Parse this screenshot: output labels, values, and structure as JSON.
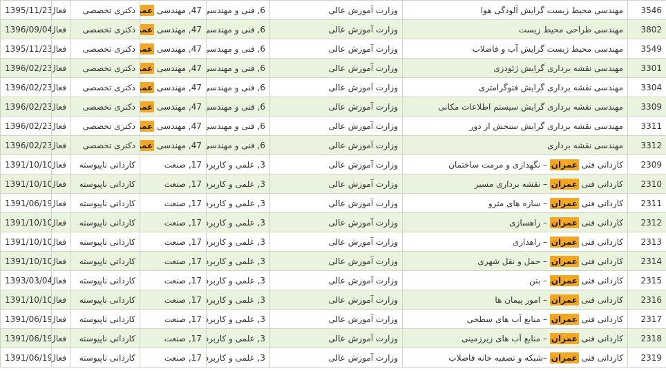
{
  "highlight": "عمران",
  "highlight_color": "#f5a623",
  "row_alt_color": "#eaf3dd",
  "rows": [
    {
      "code": "3546",
      "name_pre": "مهندسی محیط زیست گرایش آلودگی هوا",
      "name_hl": "",
      "name_post": "",
      "org": "وزارت آموزش عالی",
      "group": "6, فنی و مهندسی",
      "field_pre": "47, مهندسی ",
      "field_hl": "عمران",
      "level": "دکتری تخصصی",
      "status": "فعال",
      "date": "1395/11/23"
    },
    {
      "code": "3802",
      "name_pre": "مهندسی طراحی محیط زیست",
      "name_hl": "",
      "name_post": "",
      "org": "وزارت آموزش عالی",
      "group": "6, فنی و مهندسی",
      "field_pre": "47, مهندسی ",
      "field_hl": "عمران",
      "level": "دکتری تخصصی",
      "status": "فعال",
      "date": "1396/09/04"
    },
    {
      "code": "3549",
      "name_pre": "مهندسی محیط زیست گرایش آب و فاضلاب",
      "name_hl": "",
      "name_post": "",
      "org": "وزارت آموزش عالی",
      "group": "6, فنی و مهندسی",
      "field_pre": "47, مهندسی ",
      "field_hl": "عمران",
      "level": "دکتری تخصصی",
      "status": "فعال",
      "date": "1395/11/23"
    },
    {
      "code": "3301",
      "name_pre": "مهندسی نقشه برداری گرایش ژئودزی",
      "name_hl": "",
      "name_post": "",
      "org": "وزارت آموزش عالی",
      "group": "6, فنی و مهندسی",
      "field_pre": "47, مهندسی ",
      "field_hl": "عمران",
      "level": "دکتری تخصصی",
      "status": "فعال",
      "date": "1396/02/23"
    },
    {
      "code": "3304",
      "name_pre": "مهندسی نقشه برداری گرایش فتوگرامتری",
      "name_hl": "",
      "name_post": "",
      "org": "وزارت آموزش عالی",
      "group": "6, فنی و مهندسی",
      "field_pre": "47, مهندسی ",
      "field_hl": "عمران",
      "level": "دکتری تخصصی",
      "status": "فعال",
      "date": "1396/02/23"
    },
    {
      "code": "3309",
      "name_pre": "مهندسی نقشه برداری گرایش سیستم اطلاعات مکانی",
      "name_hl": "",
      "name_post": "",
      "org": "وزارت آموزش عالی",
      "group": "6, فنی و مهندسی",
      "field_pre": "47, مهندسی ",
      "field_hl": "عمران",
      "level": "دکتری تخصصی",
      "status": "فعال",
      "date": "1396/02/23"
    },
    {
      "code": "3311",
      "name_pre": "مهندسی نقشه برداری گرایش سنجش از دور",
      "name_hl": "",
      "name_post": "",
      "org": "وزارت آموزش عالی",
      "group": "6, فنی و مهندسی",
      "field_pre": "47, مهندسی ",
      "field_hl": "عمران",
      "level": "دکتری تخصصی",
      "status": "فعال",
      "date": "1396/02/23"
    },
    {
      "code": "3312",
      "name_pre": "مهندسی نقشه برداری",
      "name_hl": "",
      "name_post": "",
      "org": "وزارت آموزش عالی",
      "group": "6, فنی و مهندسی",
      "field_pre": "47, مهندسی ",
      "field_hl": "عمران",
      "level": "دکتری تخصصی",
      "status": "فعال",
      "date": "1396/02/23"
    },
    {
      "code": "2309",
      "name_pre": "کاردانی فنی ",
      "name_hl": "عمران",
      "name_post": " – نگهداری و مرمت ساختمان",
      "org": "وزارت آموزش عالی",
      "group": "3, علمی و کاربردی",
      "field_pre": "17, صنعت",
      "field_hl": "",
      "level": "کاردانی ناپیوسته",
      "status": "فعال",
      "date": "1391/10/10"
    },
    {
      "code": "2310",
      "name_pre": "کاردانی فنی ",
      "name_hl": "عمران",
      "name_post": " – نقشه برداری مسیر",
      "org": "وزارت آموزش عالی",
      "group": "3, علمی و کاربردی",
      "field_pre": "17, صنعت",
      "field_hl": "",
      "level": "کاردانی ناپیوسته",
      "status": "فعال",
      "date": "1391/10/10"
    },
    {
      "code": "2311",
      "name_pre": "کاردانی فنی ",
      "name_hl": "عمران",
      "name_post": " – سازه های مترو",
      "org": "وزارت آموزش عالی",
      "group": "3, علمی و کاربردی",
      "field_pre": "17, صنعت",
      "field_hl": "",
      "level": "کاردانی ناپیوسته",
      "status": "فعال",
      "date": "1391/06/19"
    },
    {
      "code": "2312",
      "name_pre": "کاردانی فنی ",
      "name_hl": "عمران",
      "name_post": " – راهسازی",
      "org": "وزارت آموزش عالی",
      "group": "3, علمی و کاربردی",
      "field_pre": "17, صنعت",
      "field_hl": "",
      "level": "کاردانی ناپیوسته",
      "status": "فعال",
      "date": "1391/10/10"
    },
    {
      "code": "2313",
      "name_pre": "کاردانی فنی ",
      "name_hl": "عمران",
      "name_post": " – راهداری",
      "org": "وزارت آموزش عالی",
      "group": "3, علمی و کاربردی",
      "field_pre": "17, صنعت",
      "field_hl": "",
      "level": "کاردانی ناپیوسته",
      "status": "فعال",
      "date": "1391/10/10"
    },
    {
      "code": "2314",
      "name_pre": "کاردانی فنی ",
      "name_hl": "عمران",
      "name_post": " – حمل و نقل شهری",
      "org": "وزارت آموزش عالی",
      "group": "3, علمی و کاربردی",
      "field_pre": "17, صنعت",
      "field_hl": "",
      "level": "کاردانی ناپیوسته",
      "status": "فعال",
      "date": "1391/10/10"
    },
    {
      "code": "2315",
      "name_pre": "کاردانی فنی ",
      "name_hl": "عمران",
      "name_post": " – بتن",
      "org": "وزارت آموزش عالی",
      "group": "3, علمی و کاربردی",
      "field_pre": "17, صنعت",
      "field_hl": "",
      "level": "کاردانی ناپیوسته",
      "status": "فعال",
      "date": "1393/03/04"
    },
    {
      "code": "2316",
      "name_pre": "کاردانی فنی ",
      "name_hl": "عمران",
      "name_post": " – امور پیمان ها",
      "org": "وزارت آموزش عالی",
      "group": "3, علمی و کاربردی",
      "field_pre": "17, صنعت",
      "field_hl": "",
      "level": "کاردانی ناپیوسته",
      "status": "فعال",
      "date": "1391/10/10"
    },
    {
      "code": "2317",
      "name_pre": "کاردانی فنی ",
      "name_hl": "عمران",
      "name_post": " – منابع آب های سطحی",
      "org": "وزارت آموزش عالی",
      "group": "3, علمی و کاربردی",
      "field_pre": "17, صنعت",
      "field_hl": "",
      "level": "کاردانی ناپیوسته",
      "status": "فعال",
      "date": "1391/06/19"
    },
    {
      "code": "2318",
      "name_pre": "کاردانی فنی ",
      "name_hl": "عمران",
      "name_post": " – منابع آب های زیرزمینی",
      "org": "وزارت آموزش عالی",
      "group": "3, علمی و کاربردی",
      "field_pre": "17, صنعت",
      "field_hl": "",
      "level": "کاردانی ناپیوسته",
      "status": "فعال",
      "date": "1391/06/19"
    },
    {
      "code": "2319",
      "name_pre": "کاردانی فنی ",
      "name_hl": "عمران",
      "name_post": " –شبکه و تصفیه خانه فاضلاب",
      "org": "وزارت آموزش عالی",
      "group": "3, علمی و کاربردی",
      "field_pre": "17, صنعت",
      "field_hl": "",
      "level": "کاردانی ناپیوسته",
      "status": "فعال",
      "date": "1391/06/19"
    }
  ]
}
